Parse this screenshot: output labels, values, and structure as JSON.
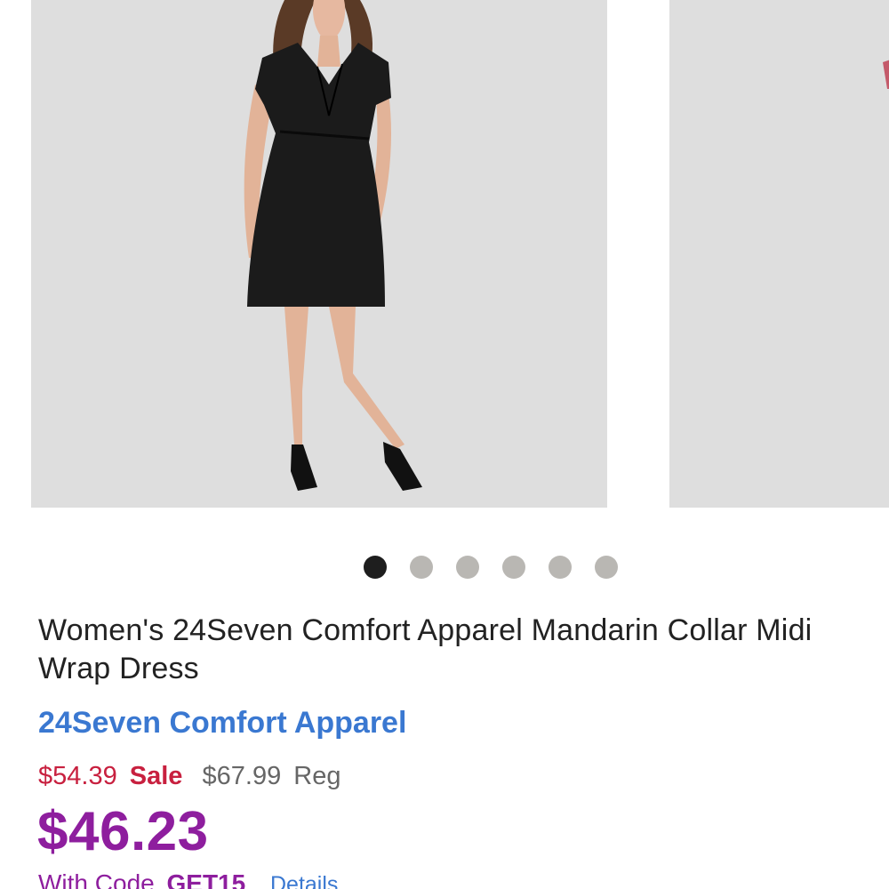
{
  "carousel": {
    "slides": [
      {
        "label": "product-photo-black-wrap-dress"
      },
      {
        "label": "product-photo-next-partial"
      }
    ],
    "dot_count": 6,
    "active_index": 0
  },
  "product": {
    "title": "Women's 24Seven Comfort Apparel Mandarin Collar Midi Wrap Dress",
    "brand": "24Seven Comfort Apparel",
    "sale_price": "$54.39",
    "sale_label": "Sale",
    "reg_price": "$67.99",
    "reg_label": "Reg",
    "promo_price": "$46.23",
    "code_prefix": "With Code",
    "code_value": "GET15",
    "details_label": "Details"
  },
  "colors": {
    "sale": "#c8203f",
    "promo": "#8e1e9e",
    "link": "#3a78d1",
    "image_bg": "#dedede",
    "dot_active": "#1e1e1e",
    "dot_inactive": "#b9b7b3"
  }
}
